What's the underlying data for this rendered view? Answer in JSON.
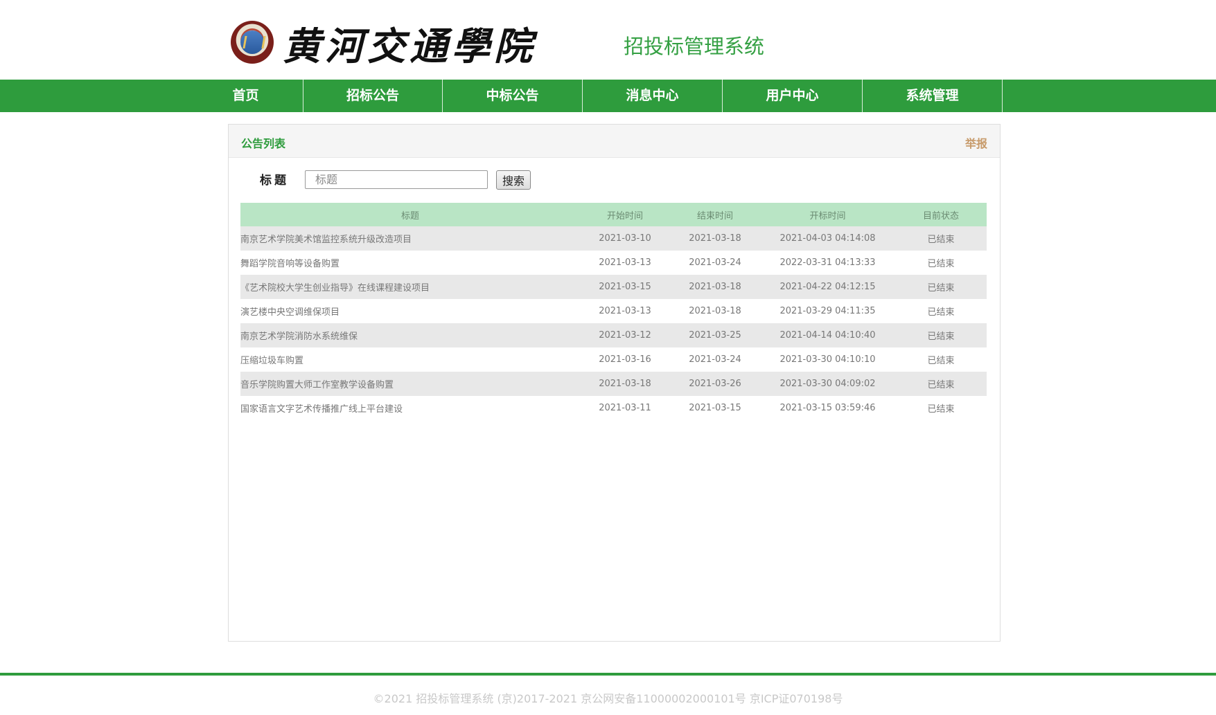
{
  "header": {
    "school_name": "黄河交通學院",
    "system_name": "招投标管理系统"
  },
  "nav": {
    "items": [
      "首页",
      "招标公告",
      "中标公告",
      "消息中心",
      "用户中心",
      "系统管理"
    ]
  },
  "panel": {
    "title": "公告列表",
    "report_link": "举报"
  },
  "search": {
    "label": "标题",
    "placeholder": "标题",
    "value": "",
    "button_label": "搜索"
  },
  "table": {
    "columns": [
      "标题",
      "开始时间",
      "结束时间",
      "开标时间",
      "目前状态"
    ],
    "rows": [
      [
        "南京艺术学院美术馆监控系统升级改造项目",
        "2021-03-10",
        "2021-03-18",
        "2021-04-03 04:14:08",
        "已结束"
      ],
      [
        "舞蹈学院音响等设备购置",
        "2021-03-13",
        "2021-03-24",
        "2022-03-31 04:13:33",
        "已结束"
      ],
      [
        "《艺术院校大学生创业指导》在线课程建设项目",
        "2021-03-15",
        "2021-03-18",
        "2021-04-22 04:12:15",
        "已结束"
      ],
      [
        "演艺楼中央空调维保项目",
        "2021-03-13",
        "2021-03-18",
        "2021-03-29 04:11:35",
        "已结束"
      ],
      [
        "南京艺术学院消防水系统维保",
        "2021-03-12",
        "2021-03-25",
        "2021-04-14 04:10:40",
        "已结束"
      ],
      [
        "压缩垃圾车购置",
        "2021-03-16",
        "2021-03-24",
        "2021-03-30 04:10:10",
        "已结束"
      ],
      [
        "音乐学院购置大师工作室教学设备购置",
        "2021-03-18",
        "2021-03-26",
        "2021-03-30 04:09:02",
        "已结束"
      ],
      [
        "国家语言文字艺术传播推广线上平台建设",
        "2021-03-11",
        "2021-03-15",
        "2021-03-15 03:59:46",
        "已结束"
      ]
    ]
  },
  "footer": {
    "copyright": "©2021 招投标管理系统 (京)2017-2021 京公网安备11000002000101号 京ICP证070198号"
  },
  "colors": {
    "brand_green": "#2e9c3d",
    "table_header": "#b9e5c5",
    "report_link": "#c79a6a"
  }
}
